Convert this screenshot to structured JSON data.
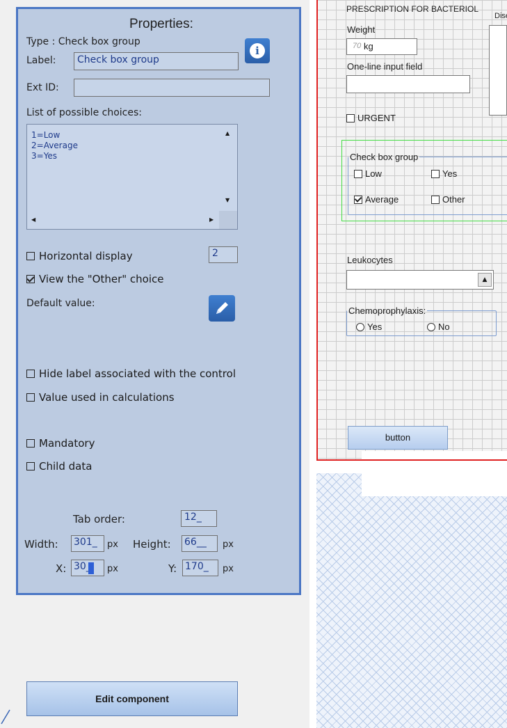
{
  "properties": {
    "title": "Properties:",
    "type_label": "Type : Check box group",
    "label_caption": "Label:",
    "label_value": "Check box group",
    "ext_id_caption": "Ext ID:",
    "ext_id_value": "",
    "choices_caption": "List of possible choices:",
    "choices": [
      "1=Low",
      "2=Average",
      "3=Yes"
    ],
    "horizontal_display_label": "Horizontal display",
    "horizontal_display_checked": false,
    "horizontal_display_value": "2",
    "view_other_label": "View the \"Other\" choice",
    "view_other_checked": true,
    "default_value_label": "Default value:",
    "hide_label_label": "Hide label associated with the control",
    "value_calc_label": "Value used in calculations",
    "mandatory_label": "Mandatory",
    "child_data_label": "Child data",
    "tab_order_caption": "Tab order:",
    "tab_order_value": "12_",
    "width_caption": "Width:",
    "width_value": "301_",
    "height_caption": "Height:",
    "height_value": "66__",
    "x_caption": "X:",
    "x_value": "30_",
    "y_caption": "Y:",
    "y_value": "170_",
    "px_unit": "px",
    "info_icon": "info-icon",
    "edit_icon": "pencil-icon"
  },
  "edit_component_label": "Edit component",
  "design": {
    "header_text": "PRESCRIPTION FOR BACTERIOL",
    "header_text_right": "Dise",
    "weight_label": "Weight",
    "weight_placeholder": "70",
    "weight_unit": "kg",
    "one_line_label": "One-line input field",
    "urgent_label": "URGENT",
    "checkbox_group_legend": "Check box group",
    "cb_low": "Low",
    "cb_yes": "Yes",
    "cb_average": "Average",
    "cb_other": "Other",
    "leukocytes_label": "Leukocytes",
    "chemo_legend": "Chemoprophylaxis:",
    "radio_yes": "Yes",
    "radio_no": "No",
    "button_label": "button"
  },
  "colors": {
    "panel_bg": "#bccbe1",
    "panel_border": "#4a76c4",
    "selection_border": "#44dd44",
    "form_border": "#e02020"
  }
}
